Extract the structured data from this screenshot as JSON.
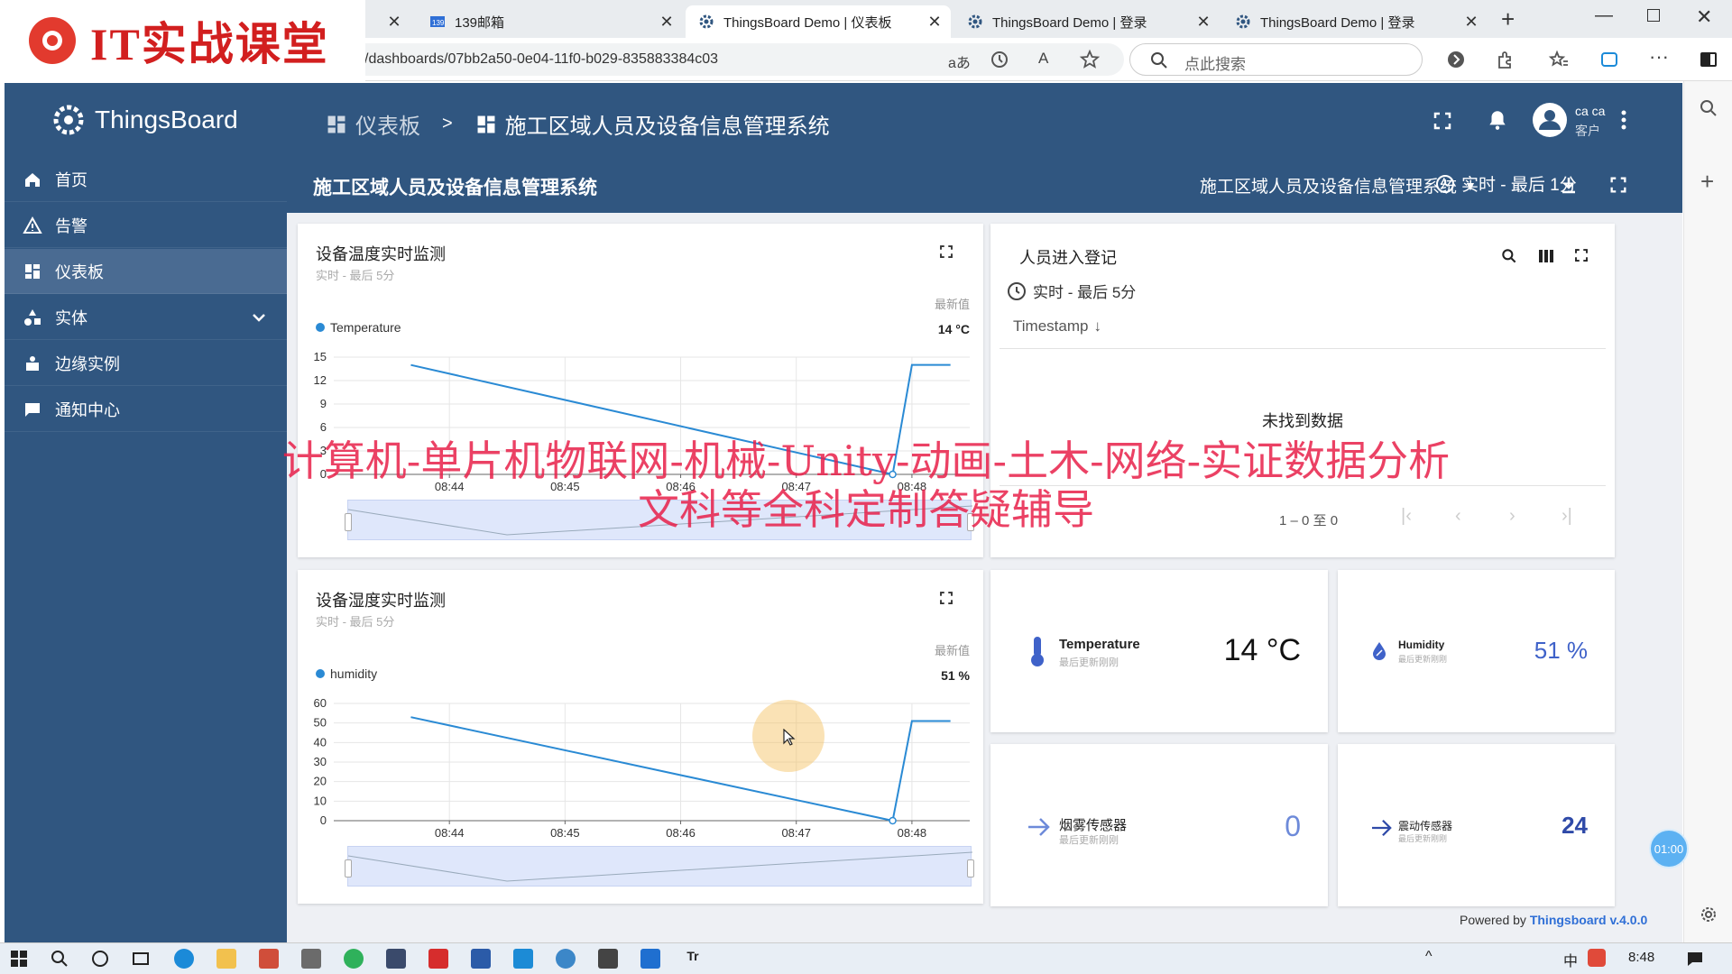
{
  "browser": {
    "tabs": [
      {
        "title": "",
        "icon": "chrome-icon"
      },
      {
        "title": "139邮箱",
        "icon": "mail-icon"
      },
      {
        "title": "ThingsBoard Demo | 仪表板",
        "icon": "thingsboard-gear-icon",
        "active": true
      },
      {
        "title": "ThingsBoard Demo | 登录",
        "icon": "thingsboard-gear-icon"
      },
      {
        "title": "ThingsBoard Demo | 登录",
        "icon": "thingsboard-gear-icon"
      }
    ],
    "url": "/dashboards/07bb2a50-0e04-11f0-b029-835883384c03",
    "search_placeholder": "点此搜索"
  },
  "watermark": {
    "logo_text": "IT实战课堂",
    "overlay_line1": "计算机-单片机物联网-机械-Unity-动画-土木-网络-实证数据分析",
    "overlay_line2": "文科等全科定制答疑辅导"
  },
  "app": {
    "name": "ThingsBoard",
    "breadcrumb": {
      "root": "仪表板",
      "sep": ">",
      "current": "施工区域人员及设备信息管理系统"
    },
    "user": {
      "name": "ca ca",
      "role": "客户"
    },
    "sidebar": [
      {
        "label": "首页",
        "icon": "home-icon"
      },
      {
        "label": "告警",
        "icon": "alert-triangle-icon"
      },
      {
        "label": "仪表板",
        "icon": "dashboard-icon",
        "active": true
      },
      {
        "label": "实体",
        "icon": "entities-icon",
        "expandable": true
      },
      {
        "label": "边缘实例",
        "icon": "edge-icon"
      },
      {
        "label": "通知中心",
        "icon": "notification-center-icon"
      }
    ],
    "dashboard": {
      "title": "施工区域人员及设备信息管理系统",
      "state_selector": "施工区域人员及设备信息管理系统",
      "timewindow": "实时 - 最后 1分"
    },
    "footer": {
      "prefix": "Powered by ",
      "link": "Thingsboard v.4.0.0"
    },
    "timer_badge": "01:00"
  },
  "widgets": {
    "temp_chart": {
      "title": "设备温度实时监测",
      "subtitle": "实时 - 最后 5分",
      "latest_label": "最新值",
      "legend": "Temperature",
      "latest_value": "14 °C"
    },
    "humid_chart": {
      "title": "设备湿度实时监测",
      "subtitle": "实时 - 最后 5分",
      "latest_label": "最新值",
      "legend": "humidity",
      "latest_value": "51 %"
    },
    "entry_table": {
      "title": "人员进入登记",
      "timewindow": "实时 - 最后 5分",
      "column": "Timestamp",
      "empty": "未找到数据",
      "pagination": "1 – 0 至 0"
    },
    "cards": [
      {
        "label": "Temperature",
        "sub": "最后更新刚刚",
        "value": "14 °C",
        "icon": "thermometer-icon"
      },
      {
        "label": "Humidity",
        "sub": "最后更新刚刚",
        "value": "51 %",
        "icon": "water-drop-icon"
      },
      {
        "label": "烟雾传感器",
        "sub": "最后更新刚刚",
        "value": "0",
        "icon": "arrow-right-icon"
      },
      {
        "label": "震动传感器",
        "sub": "最后更新刚刚",
        "value": "24",
        "icon": "arrow-right-icon"
      }
    ]
  },
  "taskbar": {
    "time": "8:48",
    "ime": "中"
  },
  "colors": {
    "primary": "#305680",
    "line": "#2a8ad4",
    "accent": "#3f62c9",
    "watermark": "#e8204a"
  },
  "chart_data": [
    {
      "type": "line",
      "name": "temperature",
      "x": [
        "08:44",
        "08:45",
        "08:46",
        "08:47",
        "08:48"
      ],
      "ylim": [
        0,
        15
      ],
      "yticks": [
        0,
        3,
        6,
        9,
        12,
        15
      ],
      "grid": true,
      "legend": "top-left",
      "series": [
        {
          "name": "Temperature",
          "points": [
            [
              "08:43:40",
              14
            ],
            [
              "08:47:50",
              0
            ],
            [
              "08:48:00",
              14
            ],
            [
              "08:48:20",
              14
            ]
          ]
        }
      ]
    },
    {
      "type": "line",
      "name": "humidity",
      "x": [
        "08:44",
        "08:45",
        "08:46",
        "08:47",
        "08:48"
      ],
      "ylim": [
        0,
        60
      ],
      "yticks": [
        0,
        10,
        20,
        30,
        40,
        50,
        60
      ],
      "grid": true,
      "legend": "top-left",
      "series": [
        {
          "name": "humidity",
          "points": [
            [
              "08:43:40",
              53
            ],
            [
              "08:47:50",
              0
            ],
            [
              "08:48:00",
              51
            ],
            [
              "08:48:20",
              51
            ]
          ]
        }
      ]
    }
  ]
}
